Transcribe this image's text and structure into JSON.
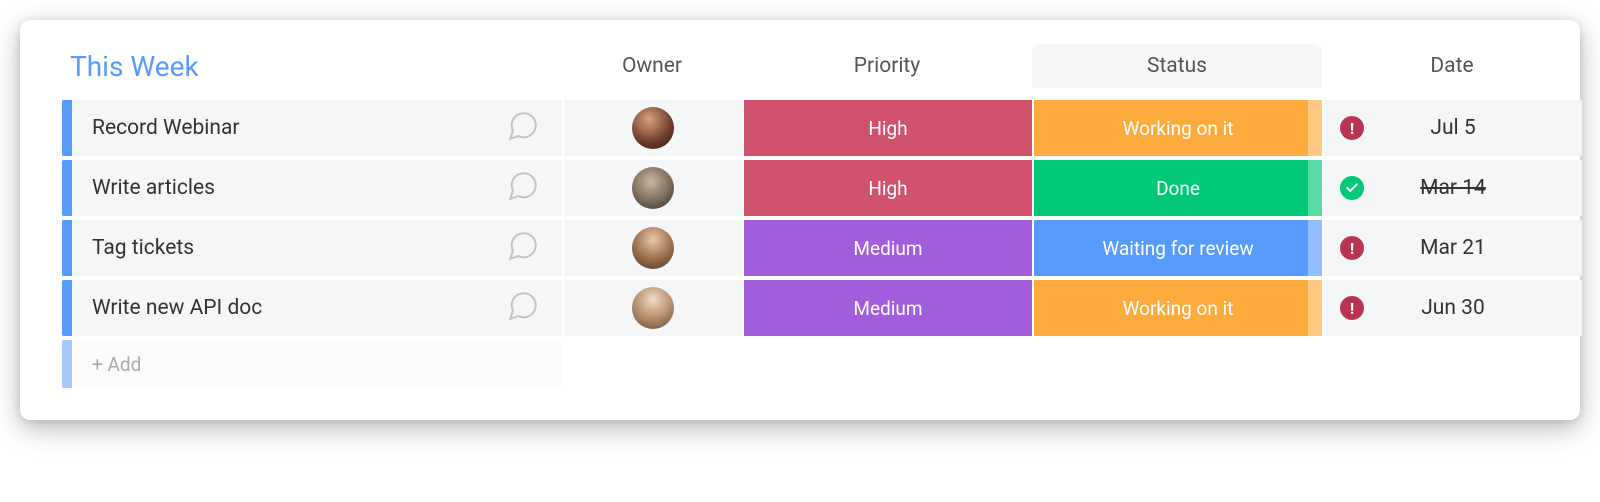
{
  "group": {
    "title": "This Week"
  },
  "columns": {
    "owner": "Owner",
    "priority": "Priority",
    "status": "Status",
    "date": "Date"
  },
  "rows": [
    {
      "name": "Record Webinar",
      "priority": {
        "label": "High",
        "class": "c-high"
      },
      "status": {
        "label": "Working on it",
        "class": "c-working"
      },
      "date": {
        "text": "Jul 5",
        "indicator": "warn",
        "strike": false
      },
      "avatar": "av1"
    },
    {
      "name": "Write articles",
      "priority": {
        "label": "High",
        "class": "c-high"
      },
      "status": {
        "label": "Done",
        "class": "c-done"
      },
      "date": {
        "text": "Mar 14",
        "indicator": "ok",
        "strike": true
      },
      "avatar": "av2"
    },
    {
      "name": "Tag tickets",
      "priority": {
        "label": "Medium",
        "class": "c-medium"
      },
      "status": {
        "label": "Waiting for review",
        "class": "c-waiting"
      },
      "date": {
        "text": "Mar 21",
        "indicator": "warn",
        "strike": false
      },
      "avatar": "av3"
    },
    {
      "name": "Write new API doc",
      "priority": {
        "label": "Medium",
        "class": "c-medium"
      },
      "status": {
        "label": "Working on it",
        "class": "c-working"
      },
      "date": {
        "text": "Jun 30",
        "indicator": "warn",
        "strike": false
      },
      "avatar": "av4"
    }
  ],
  "add_row": {
    "label": "+ Add"
  }
}
